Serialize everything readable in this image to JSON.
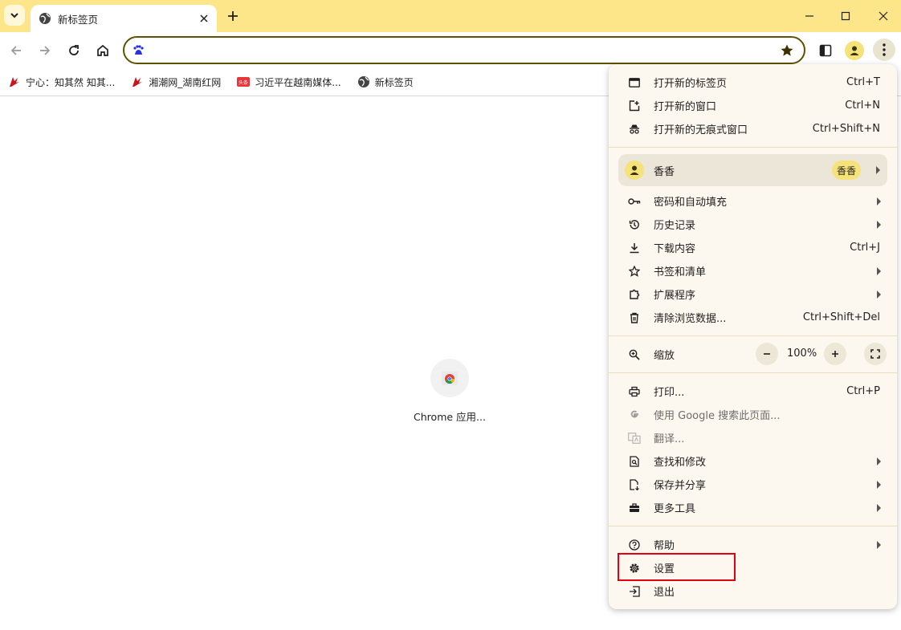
{
  "tab": {
    "title": "新标签页"
  },
  "bookmarks": [
    {
      "label": "宁心：知其然 知其..."
    },
    {
      "label": "湘潮网_湖南红网"
    },
    {
      "label": "习近平在越南媒体..."
    },
    {
      "label": "新标签页"
    }
  ],
  "bookmark_badge": "头条",
  "shortcut": {
    "label": "Chrome 应用..."
  },
  "menu": {
    "new_tab": {
      "label": "打开新的标签页",
      "shortcut": "Ctrl+T"
    },
    "new_window": {
      "label": "打开新的窗口",
      "shortcut": "Ctrl+N"
    },
    "incognito": {
      "label": "打开新的无痕式窗口",
      "shortcut": "Ctrl+Shift+N"
    },
    "profile": {
      "name": "香香",
      "chip": "香香"
    },
    "passwords": {
      "label": "密码和自动填充"
    },
    "history": {
      "label": "历史记录"
    },
    "downloads": {
      "label": "下载内容",
      "shortcut": "Ctrl+J"
    },
    "bookmarks": {
      "label": "书签和清单"
    },
    "extensions": {
      "label": "扩展程序"
    },
    "clear_data": {
      "label": "清除浏览数据...",
      "shortcut": "Ctrl+Shift+Del"
    },
    "zoom": {
      "label": "缩放",
      "value": "100%"
    },
    "print": {
      "label": "打印...",
      "shortcut": "Ctrl+P"
    },
    "google_search": {
      "label": "使用 Google 搜索此页面..."
    },
    "translate": {
      "label": "翻译..."
    },
    "find": {
      "label": "查找和修改"
    },
    "save_share": {
      "label": "保存并分享"
    },
    "more_tools": {
      "label": "更多工具"
    },
    "help": {
      "label": "帮助"
    },
    "settings": {
      "label": "设置"
    },
    "exit": {
      "label": "退出"
    }
  },
  "colors": {
    "tabstrip": "#fde58a",
    "omnibox_border": "#5e5200",
    "menu_bg": "#fdf8ef",
    "highlight": "#e3000f"
  }
}
